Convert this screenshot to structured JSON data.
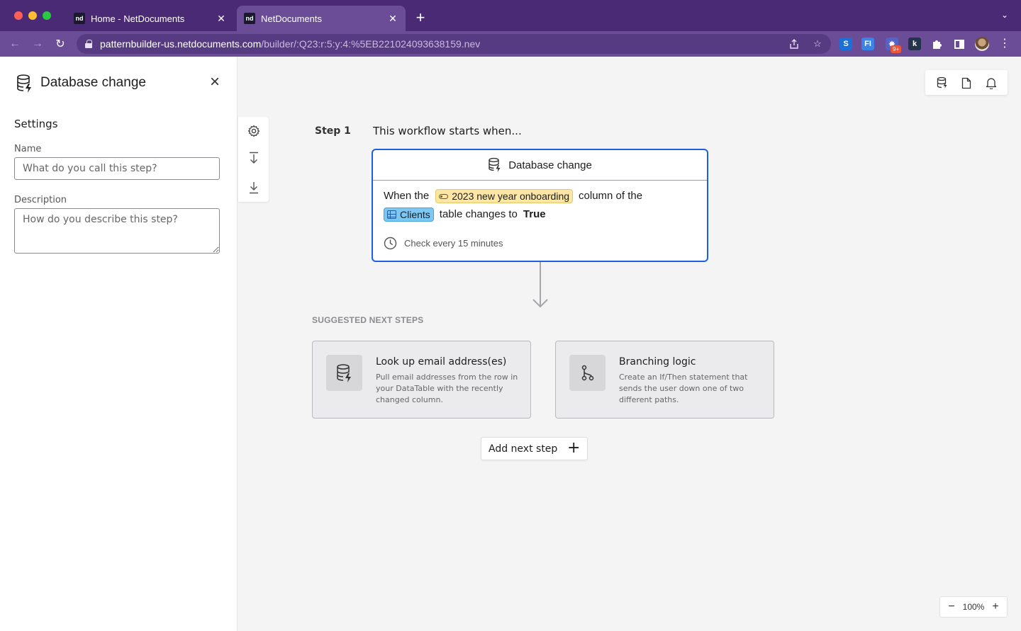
{
  "browser": {
    "tabs": [
      {
        "favicon": "nd",
        "title": "Home - NetDocuments",
        "active": false
      },
      {
        "favicon": "nd",
        "title": "NetDocuments",
        "active": true
      }
    ],
    "close_glyph": "✕",
    "new_tab_glyph": "+",
    "tab_menu_glyph": "⌄",
    "url_host": "patternbuilder-us.netdocuments.com",
    "url_path": "/builder/:Q23:r:5:y:4:%5EB221024093638159.nev",
    "extensions": [
      {
        "name": "s-extension-icon",
        "glyph": "S"
      },
      {
        "name": "f-extension-icon",
        "glyph": "FI"
      },
      {
        "name": "gear-extension-icon",
        "glyph": "✸",
        "badge": "9+"
      },
      {
        "name": "k-extension-icon",
        "glyph": "k"
      }
    ],
    "kebab_glyph": "⋮"
  },
  "panel": {
    "title": "Database change",
    "section": "Settings",
    "name_label": "Name",
    "name_placeholder": "What do you call this step?",
    "description_label": "Description",
    "description_placeholder": "How do you describe this step?"
  },
  "workflow": {
    "step_label": "Step 1",
    "step_desc": "This workflow starts when...",
    "card": {
      "title": "Database change",
      "when_text": "When the",
      "column_chip": "2023 new year onboarding",
      "column_of_text": "column of the",
      "table_chip": "Clients",
      "changes_text": "table changes to",
      "value": "True",
      "check_text": "Check every 15 minutes"
    },
    "suggested_title": "SUGGESTED NEXT STEPS",
    "suggestions": [
      {
        "title": "Look up email address(es)",
        "desc": "Pull email addresses from the row in your DataTable with the recently changed column.",
        "icon": "database-lookup-icon"
      },
      {
        "title": "Branching logic",
        "desc": "Create an If/Then statement that sends the user down one of two different paths.",
        "icon": "branch-icon"
      }
    ],
    "add_next_label": "Add next step",
    "add_next_glyph": "+"
  },
  "zoom": {
    "minus": "−",
    "value": "100%",
    "plus": "+"
  },
  "colors": {
    "accent": "#1d5fe0",
    "chrome": "#4a2a74",
    "chip_yellow": "#fbe6a6",
    "chip_blue": "#7dc7f3"
  }
}
